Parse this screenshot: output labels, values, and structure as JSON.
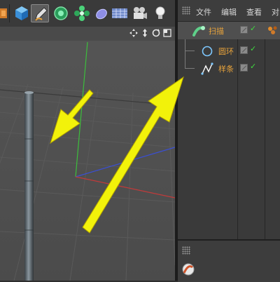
{
  "menubar": {
    "file": "文件",
    "edit": "编辑",
    "view": "查看",
    "objects": "对"
  },
  "objects": [
    {
      "name": "扫描",
      "icon": "sweep-icon",
      "enabled": true
    },
    {
      "name": "圆环",
      "icon": "circle-spline-icon",
      "enabled": true
    },
    {
      "name": "样条",
      "icon": "spline-icon",
      "enabled": true
    }
  ],
  "colors": {
    "object_name": "#e8a33b",
    "check": "#3fdc3f",
    "annotation_arrow": "#f2f20a",
    "axis_x": "#c23a3a",
    "axis_y": "#3cbf3c",
    "axis_z": "#3a4fd6"
  },
  "toolbar": {
    "icons": [
      "scale-tool-icon",
      "cube-icon",
      "pen-tool-icon",
      "subdivision-icon",
      "array-icon",
      "deformer-icon",
      "floor-icon",
      "camera-icon",
      "light-icon"
    ]
  },
  "viewport_nav": {
    "icons": [
      "move-view-icon",
      "zoom-view-icon",
      "rotate-view-icon",
      "maximize-view-icon"
    ]
  },
  "lower_panel": {
    "icons": [
      "attributes-grip-icon",
      "material-icon"
    ]
  }
}
